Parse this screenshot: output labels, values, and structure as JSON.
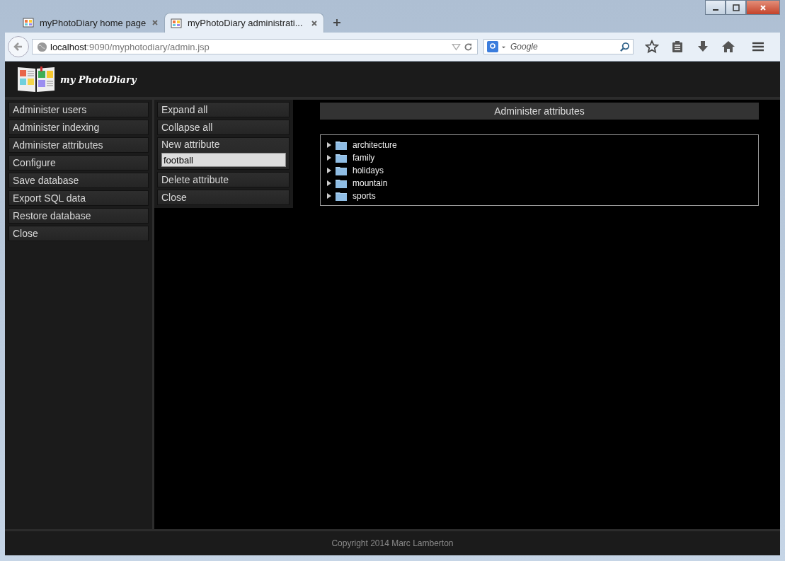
{
  "tabs": [
    {
      "title": "myPhotoDiary home page",
      "selected": false
    },
    {
      "title": "myPhotoDiary administrati...",
      "selected": true
    }
  ],
  "address": {
    "host": "localhost",
    "path": ":9090/myphotodiary/admin.jsp"
  },
  "search": {
    "placeholder": "Google"
  },
  "app": {
    "logo_text": "my PhotoDiary"
  },
  "main_menu": [
    {
      "label": "Administer users"
    },
    {
      "label": "Administer indexing"
    },
    {
      "label": "Administer attributes"
    },
    {
      "label": "Configure"
    },
    {
      "label": "Save database"
    },
    {
      "label": "Export SQL data"
    },
    {
      "label": "Restore database"
    },
    {
      "label": "Close"
    }
  ],
  "attribute_menu": [
    {
      "kind": "button",
      "label": "Expand all"
    },
    {
      "kind": "button",
      "label": "Collapse all"
    },
    {
      "kind": "input",
      "label": "New attribute",
      "value": "football"
    },
    {
      "kind": "button",
      "label": "Delete attribute"
    },
    {
      "kind": "button",
      "label": "Close"
    }
  ],
  "panel": {
    "title": "Administer attributes"
  },
  "tree": [
    {
      "label": "architecture",
      "expanded": false
    },
    {
      "label": "family",
      "expanded": false
    },
    {
      "label": "holidays",
      "expanded": false
    },
    {
      "label": "mountain",
      "expanded": false
    },
    {
      "label": "sports",
      "expanded": false
    }
  ],
  "footer": {
    "text": "Copyright 2014 Marc Lamberton"
  }
}
